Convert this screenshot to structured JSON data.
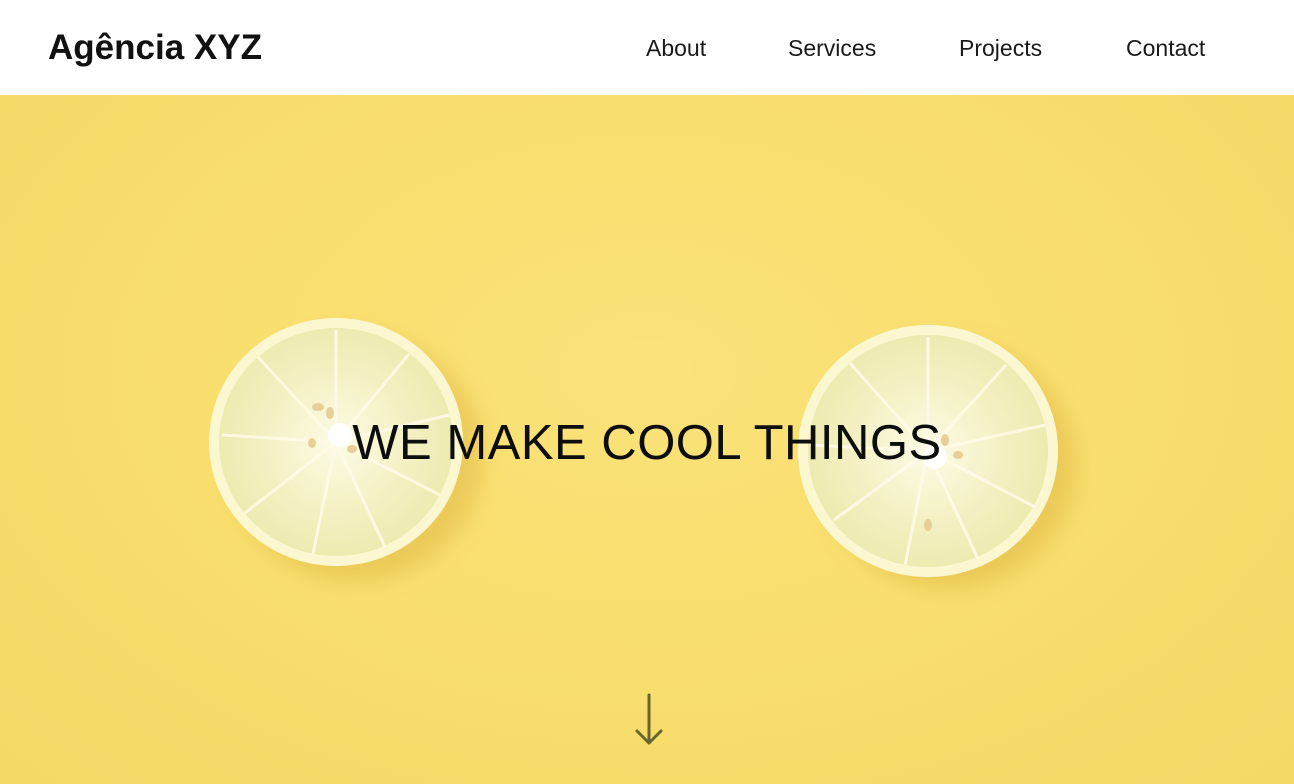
{
  "header": {
    "logo_text": "Agência XYZ",
    "nav": [
      {
        "label": "About"
      },
      {
        "label": "Services"
      },
      {
        "label": "Projects"
      },
      {
        "label": "Contact"
      }
    ]
  },
  "hero": {
    "headline": "WE MAKE COOL THINGS",
    "background_image": "two-lemon-slices-on-yellow",
    "scroll_icon": "arrow-down-icon"
  },
  "colors": {
    "header_bg": "#ffffff",
    "hero_bg": "#f9df6e",
    "text": "#111111",
    "arrow": "#666633"
  }
}
